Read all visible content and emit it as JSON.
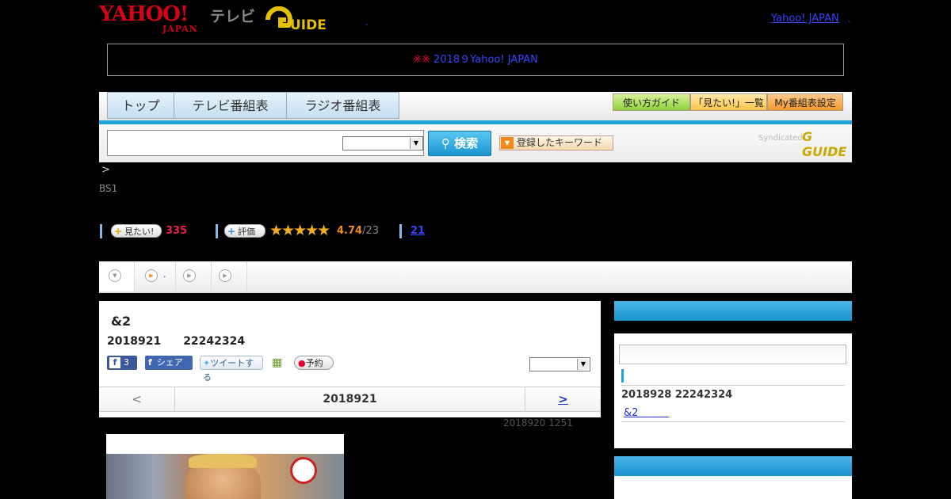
{
  "header": {
    "logo_text": "YAHOO!",
    "logo_sub": "JAPAN",
    "tv_label": "テレビ",
    "gguide_label": "G GUIDE",
    "dot_link": ".",
    "yahoo_link": "Yahoo! JAPAN",
    "yahoo_link_suffix": "."
  },
  "notice": {
    "mark": "※※",
    "text": "2018９Yahoo! JAPAN　　　　　　"
  },
  "nav": {
    "tabs": [
      "トップ",
      "テレビ番組表",
      "ラジオ番組表"
    ],
    "buttons": [
      "使い方ガイド",
      "「見たい!」一覧",
      "My番組表設定"
    ]
  },
  "search": {
    "button_label": "検索",
    "keyword_label": "登録したキーワード",
    "syndicated": "Syndicated"
  },
  "breadcrumb": ">",
  "channel": "BS1",
  "stats": {
    "want_label": "見たい!",
    "want_count": "335",
    "rate_label": "評価",
    "stars": "★★★★★",
    "rating_value": 4.74,
    "rating": "4.74",
    "rating_count": "/23",
    "comments": "21"
  },
  "media_tabs": {
    "tab2_label": "."
  },
  "program": {
    "title": "&2",
    "date_line": "2018921　　22242324",
    "fb_count": "3",
    "share_label": "シェア",
    "tweet_label": "ツイートする",
    "reserve_label": "予約",
    "prev": "<",
    "current_date": "2018921",
    "next": ">",
    "updated": "2018920  1251"
  },
  "side": {
    "next_air": "2018928  22242324",
    "next_link": "&2　　　"
  },
  "colors": {
    "accent_blue": "#1ea4d8",
    "yahoo_red": "#d60017",
    "star_gold": "#f2b021"
  }
}
